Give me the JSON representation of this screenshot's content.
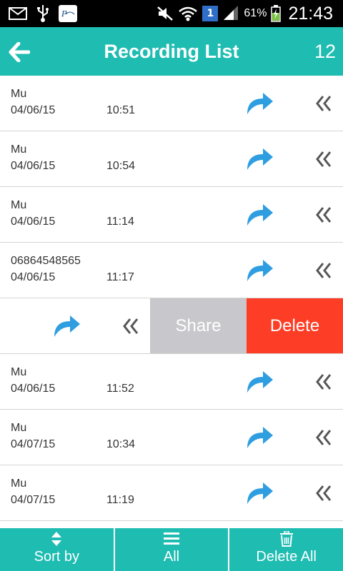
{
  "status_bar": {
    "battery_percent": "61%",
    "time": "21:43",
    "notification_badge": "1",
    "icons": [
      "mail-icon",
      "usb-icon",
      "app-logo-icon",
      "mute-icon",
      "wifi-icon",
      "signal-icon",
      "battery-charging-icon"
    ]
  },
  "header": {
    "title": "Recording List",
    "count": "12",
    "back_icon": "arrow-left-icon"
  },
  "recordings": [
    {
      "name": "Mu",
      "date": "04/06/15",
      "time": "10:51"
    },
    {
      "name": "Mu",
      "date": "04/06/15",
      "time": "10:54"
    },
    {
      "name": "Mu",
      "date": "04/06/15",
      "time": "11:14"
    },
    {
      "name": "06864548565",
      "date": "04/06/15",
      "time": "11:17"
    },
    {
      "name": "",
      "date": "",
      "time": "",
      "swiped": true
    },
    {
      "name": "Mu",
      "date": "04/06/15",
      "time": "11:52"
    },
    {
      "name": "Mu",
      "date": "04/07/15",
      "time": "10:34"
    },
    {
      "name": "Mu",
      "date": "04/07/15",
      "time": "11:19"
    }
  ],
  "swipe_actions": {
    "share_label": "Share",
    "delete_label": "Delete"
  },
  "colors": {
    "accent": "#1fbcb2",
    "share_icon": "#2f9ee0",
    "delete": "#fd3d25",
    "share_action_bg": "#c8c7cc"
  },
  "bottom_bar": {
    "sort_label": "Sort by",
    "all_label": "All",
    "delete_all_label": "Delete All"
  }
}
